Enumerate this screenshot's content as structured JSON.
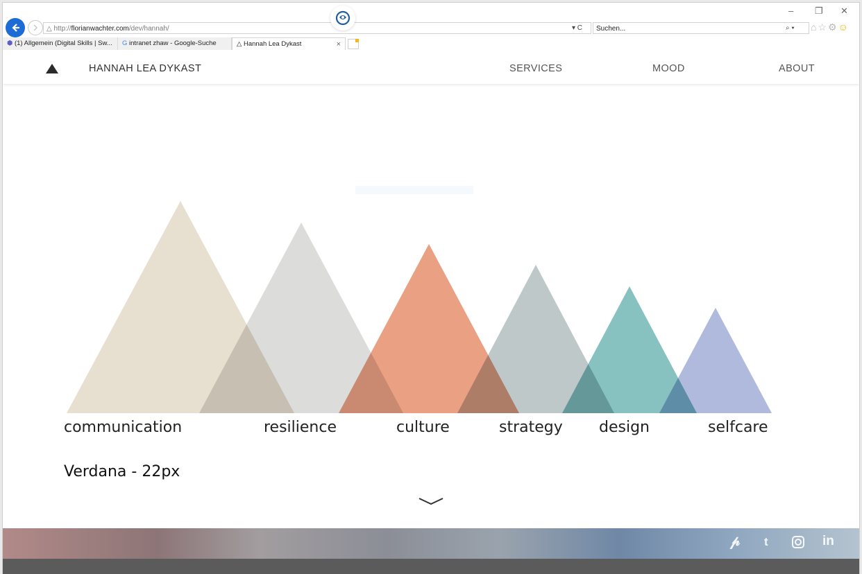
{
  "browser": {
    "url_prefix": "http://",
    "url_domain": "florianwachter.com",
    "url_path": "/dev/hannah/",
    "address_controls": "▾ C",
    "search_placeholder": "Suchen...",
    "search_controls": "⌕ ▾",
    "window_controls": {
      "minimize": "–",
      "restore": "❐",
      "close": "✕"
    },
    "tabs": [
      {
        "label": "(1) Allgemein (Digital Skills | Sw..."
      },
      {
        "label": "intranet zhaw - Google-Suche"
      },
      {
        "label": "Hannah Lea Dykast"
      }
    ],
    "tab_close": "×"
  },
  "site": {
    "brand": "HANNAH LEA DYKAST",
    "nav": [
      "SERVICES",
      "MOOD",
      "ABOUT"
    ]
  },
  "mountains": {
    "colors": {
      "communication": "#e7dfcf",
      "resilience": "#dcdcdb",
      "culture": "#e9a083",
      "strategy": "#bfc8c9",
      "design": "#87c2c1",
      "selfcare": "#afbadd"
    },
    "labels": [
      "communication",
      "resilience",
      "culture",
      "strategy",
      "design",
      "selfcare"
    ]
  },
  "font_note": "Verdana - 22px",
  "footer": {
    "band_colors": [
      "#b18a88",
      "#8d7577",
      "#a29d9f",
      "#8b8e97",
      "#9aa3ad",
      "#6f88a6",
      "#8ea6bf",
      "#b4c3cf"
    ],
    "dark_color": "#5b5b5b",
    "social": [
      "pinterest-icon",
      "tumblr-icon",
      "instagram-icon",
      "linkedin-icon"
    ]
  }
}
